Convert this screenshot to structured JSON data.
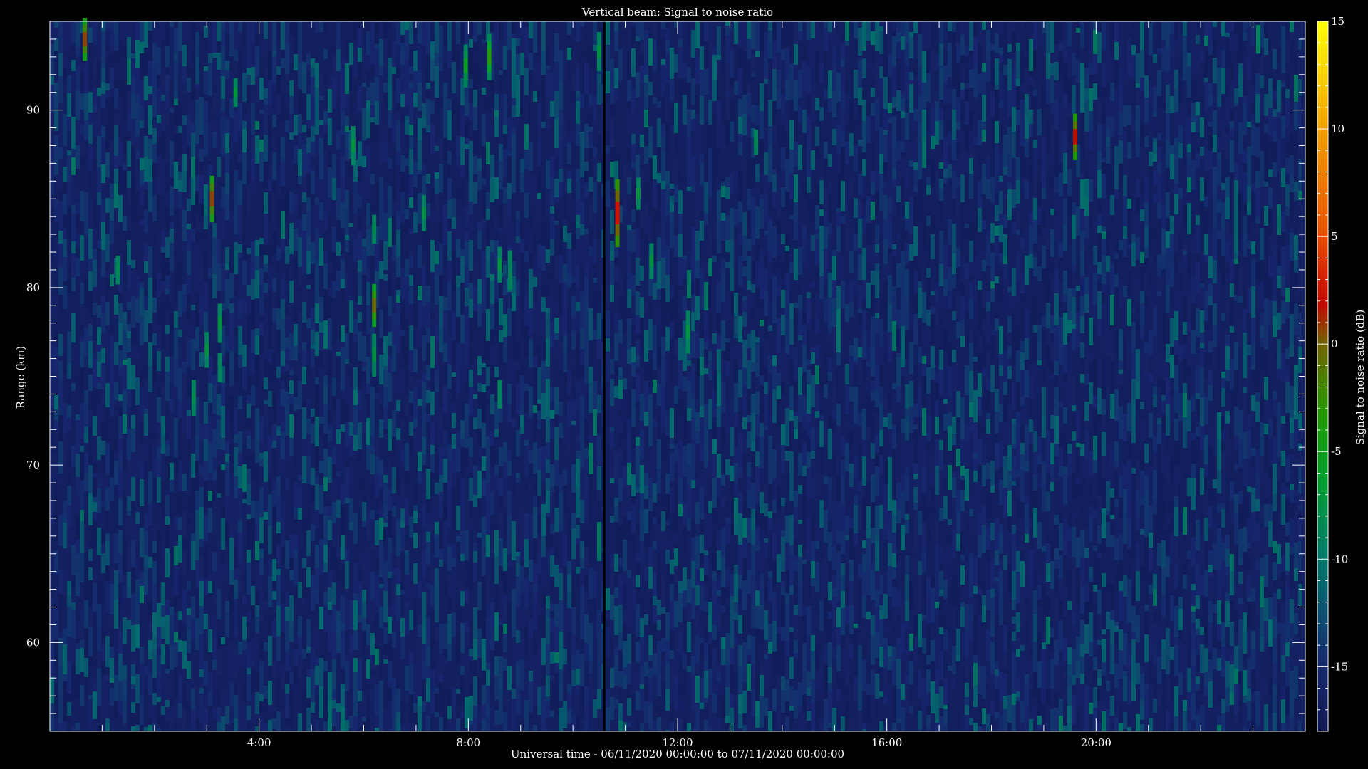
{
  "chart_data": {
    "type": "heatmap",
    "title": "Vertical beam: Signal to noise ratio",
    "xlabel": "Universal time - 06/11/2020 00:00:00 to 07/11/2020 00:00:00",
    "ylabel": "Range (km)",
    "colorbar_label": "Signal to noise ratio (dB)",
    "x_unit": "hours UT",
    "xlim": [
      0,
      24
    ],
    "ylim": [
      55,
      95
    ],
    "clim": [
      -18,
      15
    ],
    "x_ticks": [
      {
        "value": 4,
        "label": "4:00"
      },
      {
        "value": 8,
        "label": "8:00"
      },
      {
        "value": 12,
        "label": "12:00"
      },
      {
        "value": 16,
        "label": "16:00"
      },
      {
        "value": 20,
        "label": "20:00"
      }
    ],
    "y_ticks": [
      {
        "value": 60,
        "label": "60"
      },
      {
        "value": 70,
        "label": "70"
      },
      {
        "value": 80,
        "label": "80"
      },
      {
        "value": 90,
        "label": "90"
      }
    ],
    "colorbar_ticks": [
      {
        "value": 15,
        "label": "15"
      },
      {
        "value": 10,
        "label": "10"
      },
      {
        "value": 5,
        "label": "5"
      },
      {
        "value": 0,
        "label": "0"
      },
      {
        "value": -5,
        "label": "-5"
      },
      {
        "value": -10,
        "label": "-10"
      },
      {
        "value": -15,
        "label": "-15"
      }
    ],
    "background_snr_db": -16,
    "data_gap": {
      "time_h": 10.6
    },
    "echoes": [
      {
        "time_h": 0.67,
        "range_km": 94.0,
        "height_km": 2.4,
        "snr_db": 2
      },
      {
        "time_h": 3.55,
        "range_km": 91.0,
        "height_km": 1.6,
        "snr_db": -6
      },
      {
        "time_h": 5.8,
        "range_km": 88.0,
        "height_km": 2.2,
        "snr_db": -6
      },
      {
        "time_h": 7.95,
        "range_km": 92.5,
        "height_km": 2.4,
        "snr_db": -4
      },
      {
        "time_h": 8.4,
        "range_km": 93.0,
        "height_km": 2.6,
        "snr_db": -2
      },
      {
        "time_h": 10.5,
        "range_km": 93.3,
        "height_km": 2.2,
        "snr_db": -6
      },
      {
        "time_h": 19.6,
        "range_km": 88.5,
        "height_km": 2.6,
        "snr_db": 3
      },
      {
        "time_h": 3.1,
        "range_km": 85.0,
        "height_km": 2.6,
        "snr_db": 2
      },
      {
        "time_h": 7.15,
        "range_km": 84.2,
        "height_km": 2.0,
        "snr_db": -6
      },
      {
        "time_h": 10.85,
        "range_km": 84.2,
        "height_km": 3.8,
        "snr_db": 4
      },
      {
        "time_h": 11.25,
        "range_km": 85.3,
        "height_km": 1.8,
        "snr_db": -6
      },
      {
        "time_h": 11.5,
        "range_km": 81.5,
        "height_km": 2.0,
        "snr_db": -6
      },
      {
        "time_h": 8.6,
        "range_km": 81.3,
        "height_km": 2.0,
        "snr_db": -6
      },
      {
        "time_h": 8.8,
        "range_km": 81.0,
        "height_km": 2.2,
        "snr_db": -8
      },
      {
        "time_h": 13.5,
        "range_km": 88.2,
        "height_km": 1.4,
        "snr_db": -7
      },
      {
        "time_h": 6.2,
        "range_km": 83.3,
        "height_km": 1.6,
        "snr_db": -7
      },
      {
        "time_h": 1.3,
        "range_km": 81.0,
        "height_km": 1.6,
        "snr_db": -7
      },
      {
        "time_h": 6.2,
        "range_km": 79.0,
        "height_km": 2.4,
        "snr_db": 1
      },
      {
        "time_h": 6.2,
        "range_km": 76.2,
        "height_km": 2.4,
        "snr_db": -6
      },
      {
        "time_h": 3.25,
        "range_km": 78.0,
        "height_km": 2.2,
        "snr_db": -6
      },
      {
        "time_h": 3.0,
        "range_km": 76.5,
        "height_km": 2.0,
        "snr_db": -6
      },
      {
        "time_h": 3.25,
        "range_km": 75.5,
        "height_km": 1.6,
        "snr_db": -9
      },
      {
        "time_h": 2.75,
        "range_km": 73.8,
        "height_km": 2.0,
        "snr_db": -7
      },
      {
        "time_h": 8.6,
        "range_km": 74.0,
        "height_km": 1.6,
        "snr_db": -10
      },
      {
        "time_h": 12.2,
        "range_km": 77.5,
        "height_km": 2.4,
        "snr_db": -6
      },
      {
        "time_h": 23.1,
        "range_km": 94.0,
        "height_km": 1.6,
        "snr_db": -9
      }
    ]
  }
}
